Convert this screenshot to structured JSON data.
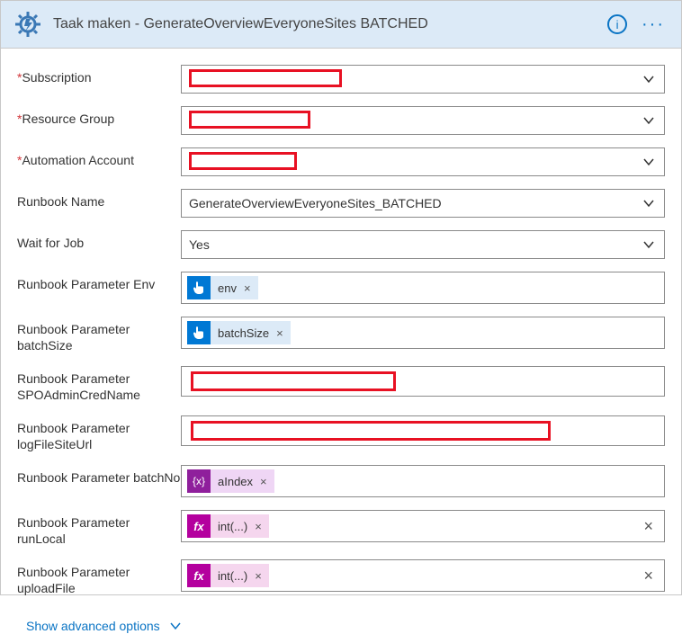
{
  "header": {
    "title": "Taak maken - GenerateOverviewEveryoneSites BATCHED"
  },
  "fields": {
    "subscription_label": "Subscription",
    "resource_group_label": "Resource Group",
    "automation_account_label": "Automation Account",
    "runbook_name_label": "Runbook Name",
    "runbook_name_value": "GenerateOverviewEveryoneSites_BATCHED",
    "wait_for_job_label": "Wait for Job",
    "wait_for_job_value": "Yes",
    "param_env_label": "Runbook Parameter Env",
    "param_env_token": "env",
    "param_batchsize_label": "Runbook Parameter batchSize",
    "param_batchsize_token": "batchSize",
    "param_spoadmin_label": "Runbook Parameter SPOAdminCredName",
    "param_logfile_label": "Runbook Parameter logFileSiteUrl",
    "param_batchno_label": "Runbook Parameter batchNo",
    "param_batchno_token": "aIndex",
    "param_runlocal_label": "Runbook Parameter runLocal",
    "param_runlocal_token": "int(...)",
    "param_uploadfile_label": "Runbook Parameter uploadFile",
    "param_uploadfile_token": "int(...)"
  },
  "advanced_link": "Show advanced options",
  "glyph": {
    "clear": "×",
    "dots": "···",
    "info": "i"
  },
  "icon_fx": "fx",
  "icon_var": "{x}"
}
